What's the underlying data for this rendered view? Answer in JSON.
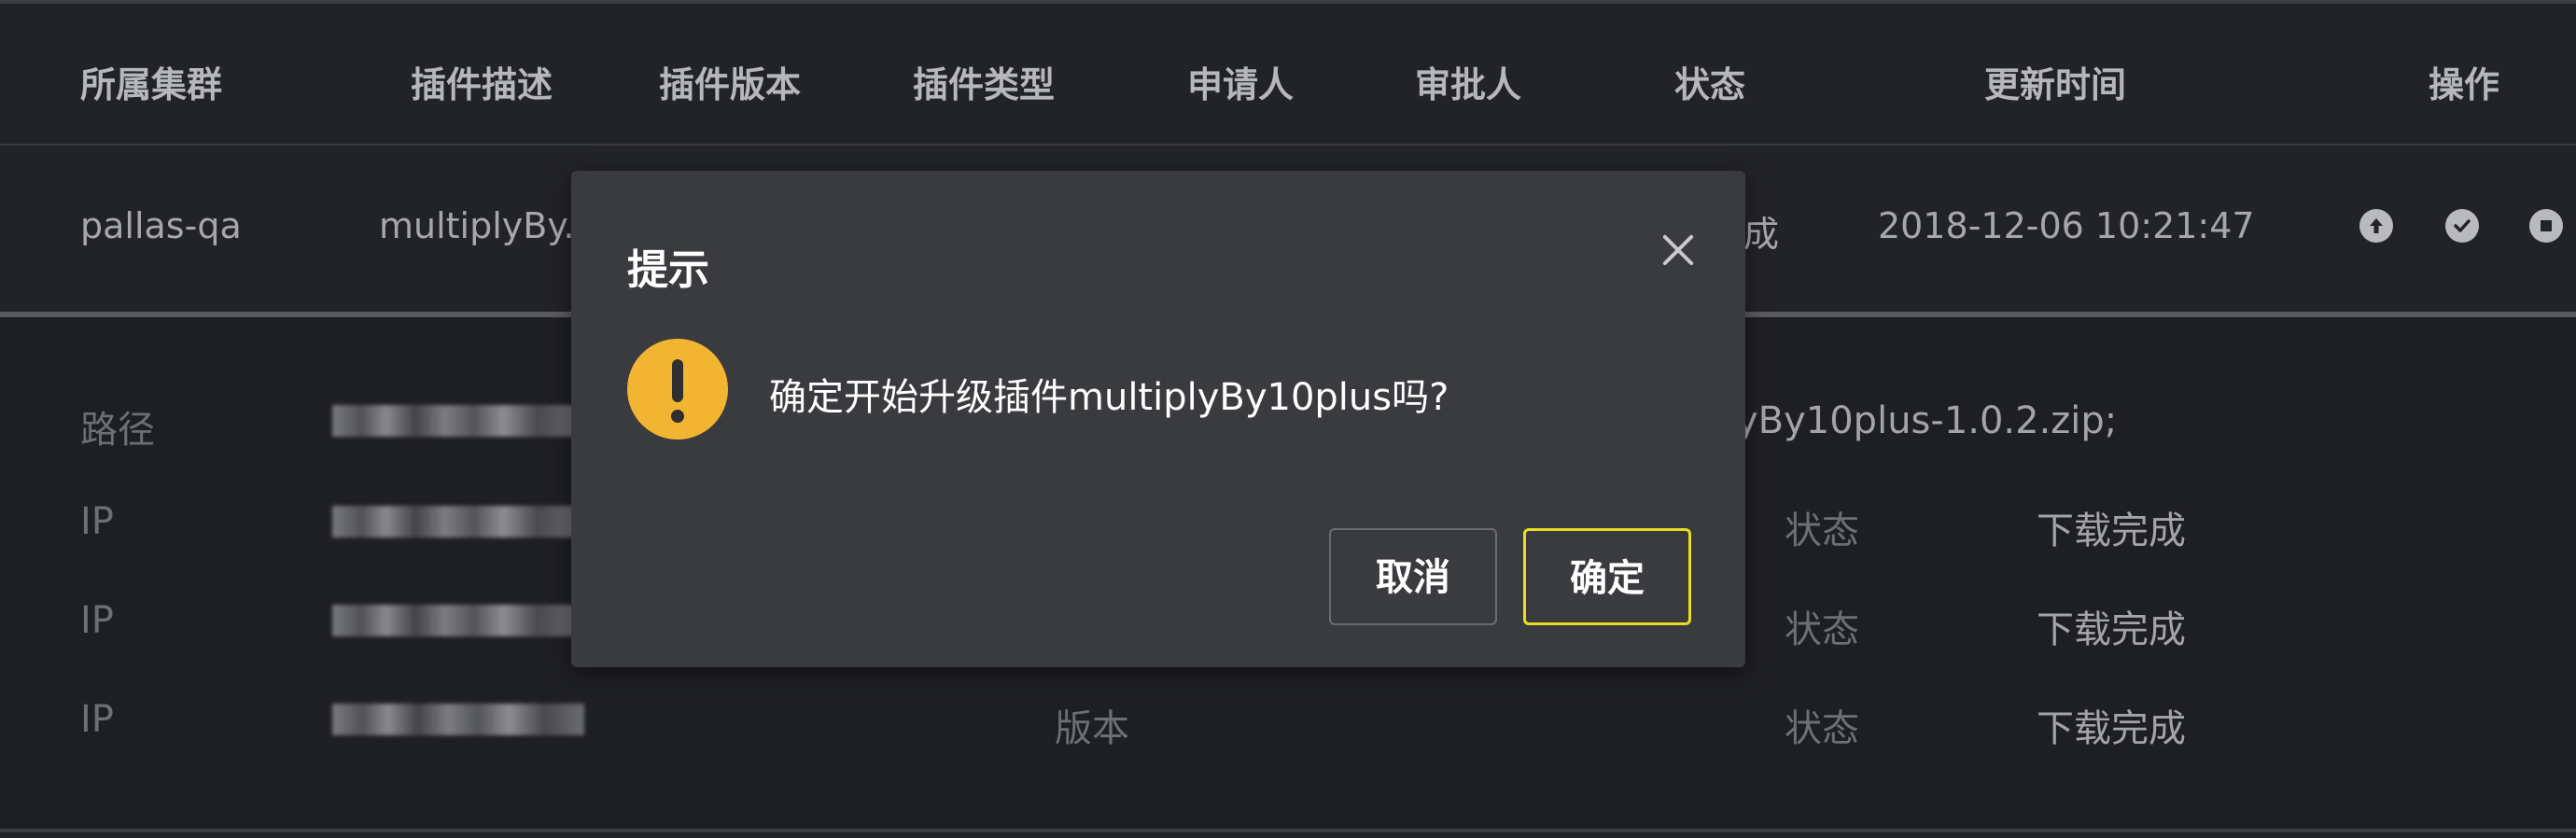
{
  "table": {
    "headers": [
      "所属集群",
      "插件描述",
      "插件版本",
      "插件类型",
      "申请人",
      "审批人",
      "状态",
      "更新时间",
      "操作"
    ],
    "row": {
      "cluster": "pallas-qa",
      "description": "multiplyBy...",
      "status": "完成",
      "updated": "2018-12-06 10:21:47",
      "actions": [
        "upgrade-icon",
        "check-circle-icon",
        "stop-circle-icon"
      ]
    }
  },
  "detail": {
    "path_label": "路径",
    "path_value_suffix": "yBy10plus-1.0.2.zip;",
    "nodes": [
      {
        "ip_label": "IP",
        "status_label": "状态",
        "status_value": "下载完成"
      },
      {
        "ip_label": "IP",
        "status_label": "状态",
        "status_value": "下载完成"
      },
      {
        "ip_label": "IP",
        "version_label": "版本",
        "status_label": "状态",
        "status_value": "下载完成"
      }
    ]
  },
  "modal": {
    "title": "提示",
    "message": "确定开始升级插件multiplyBy10plus吗?",
    "cancel_label": "取消",
    "ok_label": "确定",
    "icon": "warning-icon",
    "colors": {
      "warning": "#f2b531",
      "ok_border": "#e9dd22",
      "background": "#3a3b3e"
    }
  }
}
